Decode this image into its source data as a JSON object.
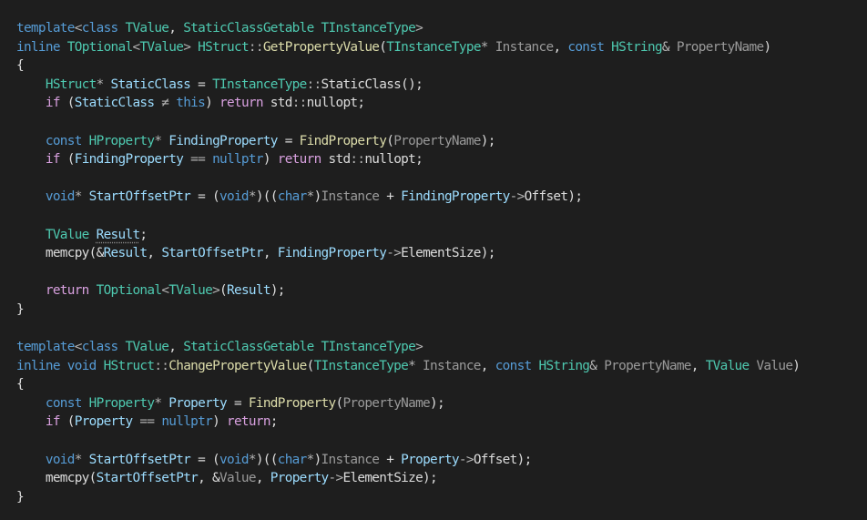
{
  "editor": {
    "lines": [
      [
        [
          "template",
          "kw"
        ],
        [
          "<",
          "op"
        ],
        [
          "class",
          "kw"
        ],
        [
          " ",
          "txt"
        ],
        [
          "TValue",
          "type"
        ],
        [
          ", ",
          "txt"
        ],
        [
          "StaticClassGetable",
          "type"
        ],
        [
          " ",
          "txt"
        ],
        [
          "TInstanceType",
          "type"
        ],
        [
          ">",
          "op"
        ]
      ],
      [
        [
          "inline",
          "kw"
        ],
        [
          " ",
          "txt"
        ],
        [
          "TOptional",
          "type"
        ],
        [
          "<",
          "op"
        ],
        [
          "TValue",
          "type"
        ],
        [
          ">",
          "op"
        ],
        [
          " ",
          "txt"
        ],
        [
          "HStruct",
          "type"
        ],
        [
          "::",
          "op"
        ],
        [
          "GetPropertyValue",
          "fn"
        ],
        [
          "(",
          "txt"
        ],
        [
          "TInstanceType",
          "type"
        ],
        [
          "*",
          "op"
        ],
        [
          " ",
          "txt"
        ],
        [
          "Instance",
          "param"
        ],
        [
          ", ",
          "txt"
        ],
        [
          "const",
          "kw"
        ],
        [
          " ",
          "txt"
        ],
        [
          "HString",
          "type"
        ],
        [
          "&",
          "op"
        ],
        [
          " ",
          "txt"
        ],
        [
          "PropertyName",
          "param"
        ],
        [
          ")",
          "txt"
        ]
      ],
      [
        [
          "{",
          "txt"
        ]
      ],
      [
        [
          "    ",
          "txt"
        ],
        [
          "HStruct",
          "type"
        ],
        [
          "*",
          "op"
        ],
        [
          " ",
          "txt"
        ],
        [
          "StaticClass",
          "var"
        ],
        [
          " = ",
          "txt"
        ],
        [
          "TInstanceType",
          "type"
        ],
        [
          "::",
          "op"
        ],
        [
          "StaticClass",
          "txt"
        ],
        [
          "();",
          "txt"
        ]
      ],
      [
        [
          "    ",
          "txt"
        ],
        [
          "if",
          "ctl"
        ],
        [
          " (",
          "txt"
        ],
        [
          "StaticClass",
          "var"
        ],
        [
          " ≠ ",
          "op"
        ],
        [
          "this",
          "kw"
        ],
        [
          ") ",
          "txt"
        ],
        [
          "return",
          "ctl"
        ],
        [
          " std",
          "txt"
        ],
        [
          "::",
          "op"
        ],
        [
          "nullopt;",
          "txt"
        ]
      ],
      [],
      [
        [
          "    ",
          "txt"
        ],
        [
          "const",
          "kw"
        ],
        [
          " ",
          "txt"
        ],
        [
          "HProperty",
          "type"
        ],
        [
          "*",
          "op"
        ],
        [
          " ",
          "txt"
        ],
        [
          "FindingProperty",
          "var"
        ],
        [
          " = ",
          "txt"
        ],
        [
          "FindProperty",
          "fn"
        ],
        [
          "(",
          "txt"
        ],
        [
          "PropertyName",
          "param"
        ],
        [
          ");",
          "txt"
        ]
      ],
      [
        [
          "    ",
          "txt"
        ],
        [
          "if",
          "ctl"
        ],
        [
          " (",
          "txt"
        ],
        [
          "FindingProperty",
          "var"
        ],
        [
          " == ",
          "op"
        ],
        [
          "nullptr",
          "kw"
        ],
        [
          ") ",
          "txt"
        ],
        [
          "return",
          "ctl"
        ],
        [
          " std",
          "txt"
        ],
        [
          "::",
          "op"
        ],
        [
          "nullopt;",
          "txt"
        ]
      ],
      [],
      [
        [
          "    ",
          "txt"
        ],
        [
          "void",
          "kw"
        ],
        [
          "*",
          "op"
        ],
        [
          " ",
          "txt"
        ],
        [
          "StartOffsetPtr",
          "var"
        ],
        [
          " = (",
          "txt"
        ],
        [
          "void",
          "kw"
        ],
        [
          "*",
          "op"
        ],
        [
          ")((",
          "txt"
        ],
        [
          "char",
          "kw"
        ],
        [
          "*",
          "op"
        ],
        [
          ")",
          "txt"
        ],
        [
          "Instance",
          "param"
        ],
        [
          " + ",
          "txt"
        ],
        [
          "FindingProperty",
          "var"
        ],
        [
          "->",
          "op"
        ],
        [
          "Offset);",
          "txt"
        ]
      ],
      [],
      [
        [
          "    ",
          "txt"
        ],
        [
          "TValue",
          "type"
        ],
        [
          " ",
          "txt"
        ],
        [
          "Result",
          "var",
          "squiggle"
        ],
        [
          ";",
          "txt"
        ]
      ],
      [
        [
          "    ",
          "txt"
        ],
        [
          "memcpy",
          "txt"
        ],
        [
          "(&",
          "txt"
        ],
        [
          "Result",
          "var"
        ],
        [
          ", ",
          "txt"
        ],
        [
          "StartOffsetPtr",
          "var"
        ],
        [
          ", ",
          "txt"
        ],
        [
          "FindingProperty",
          "var"
        ],
        [
          "->",
          "op"
        ],
        [
          "ElementSize);",
          "txt"
        ]
      ],
      [],
      [
        [
          "    ",
          "txt"
        ],
        [
          "return",
          "ctl"
        ],
        [
          " ",
          "txt"
        ],
        [
          "TOptional",
          "type"
        ],
        [
          "<",
          "op"
        ],
        [
          "TValue",
          "type"
        ],
        [
          ">",
          "op"
        ],
        [
          "(",
          "txt"
        ],
        [
          "Result",
          "var"
        ],
        [
          ");",
          "txt"
        ]
      ],
      [
        [
          "}",
          "txt"
        ]
      ],
      [],
      [
        [
          "template",
          "kw"
        ],
        [
          "<",
          "op"
        ],
        [
          "class",
          "kw"
        ],
        [
          " ",
          "txt"
        ],
        [
          "TValue",
          "type"
        ],
        [
          ", ",
          "txt"
        ],
        [
          "StaticClassGetable",
          "type"
        ],
        [
          " ",
          "txt"
        ],
        [
          "TInstanceType",
          "type"
        ],
        [
          ">",
          "op"
        ]
      ],
      [
        [
          "inline",
          "kw"
        ],
        [
          " ",
          "txt"
        ],
        [
          "void",
          "kw"
        ],
        [
          " ",
          "txt"
        ],
        [
          "HStruct",
          "type"
        ],
        [
          "::",
          "op"
        ],
        [
          "ChangePropertyValue",
          "fn"
        ],
        [
          "(",
          "txt"
        ],
        [
          "TInstanceType",
          "type"
        ],
        [
          "*",
          "op"
        ],
        [
          " ",
          "txt"
        ],
        [
          "Instance",
          "param"
        ],
        [
          ", ",
          "txt"
        ],
        [
          "const",
          "kw"
        ],
        [
          " ",
          "txt"
        ],
        [
          "HString",
          "type"
        ],
        [
          "&",
          "op"
        ],
        [
          " ",
          "txt"
        ],
        [
          "PropertyName",
          "param"
        ],
        [
          ", ",
          "txt"
        ],
        [
          "TValue",
          "type"
        ],
        [
          " ",
          "txt"
        ],
        [
          "Value",
          "param"
        ],
        [
          ")",
          "txt"
        ]
      ],
      [
        [
          "{",
          "txt"
        ]
      ],
      [
        [
          "    ",
          "txt"
        ],
        [
          "const",
          "kw"
        ],
        [
          " ",
          "txt"
        ],
        [
          "HProperty",
          "type"
        ],
        [
          "*",
          "op"
        ],
        [
          " ",
          "txt"
        ],
        [
          "Property",
          "var"
        ],
        [
          " = ",
          "txt"
        ],
        [
          "FindProperty",
          "fn"
        ],
        [
          "(",
          "txt"
        ],
        [
          "PropertyName",
          "param"
        ],
        [
          ");",
          "txt"
        ]
      ],
      [
        [
          "    ",
          "txt"
        ],
        [
          "if",
          "ctl"
        ],
        [
          " (",
          "txt"
        ],
        [
          "Property",
          "var"
        ],
        [
          " == ",
          "op"
        ],
        [
          "nullptr",
          "kw"
        ],
        [
          ") ",
          "txt"
        ],
        [
          "return",
          "ctl"
        ],
        [
          ";",
          "txt"
        ]
      ],
      [],
      [
        [
          "    ",
          "txt"
        ],
        [
          "void",
          "kw"
        ],
        [
          "*",
          "op"
        ],
        [
          " ",
          "txt"
        ],
        [
          "StartOffsetPtr",
          "var"
        ],
        [
          " = (",
          "txt"
        ],
        [
          "void",
          "kw"
        ],
        [
          "*",
          "op"
        ],
        [
          ")((",
          "txt"
        ],
        [
          "char",
          "kw"
        ],
        [
          "*",
          "op"
        ],
        [
          ")",
          "txt"
        ],
        [
          "Instance",
          "param"
        ],
        [
          " + ",
          "txt"
        ],
        [
          "Property",
          "var"
        ],
        [
          "->",
          "op"
        ],
        [
          "Offset);",
          "txt"
        ]
      ],
      [
        [
          "    ",
          "txt"
        ],
        [
          "memcpy",
          "txt"
        ],
        [
          "(",
          "txt"
        ],
        [
          "StartOffsetPtr",
          "var"
        ],
        [
          ", &",
          "txt"
        ],
        [
          "Value",
          "param"
        ],
        [
          ", ",
          "txt"
        ],
        [
          "Property",
          "var"
        ],
        [
          "->",
          "op"
        ],
        [
          "ElementSize);",
          "txt"
        ]
      ],
      [
        [
          "}",
          "txt"
        ]
      ]
    ]
  }
}
